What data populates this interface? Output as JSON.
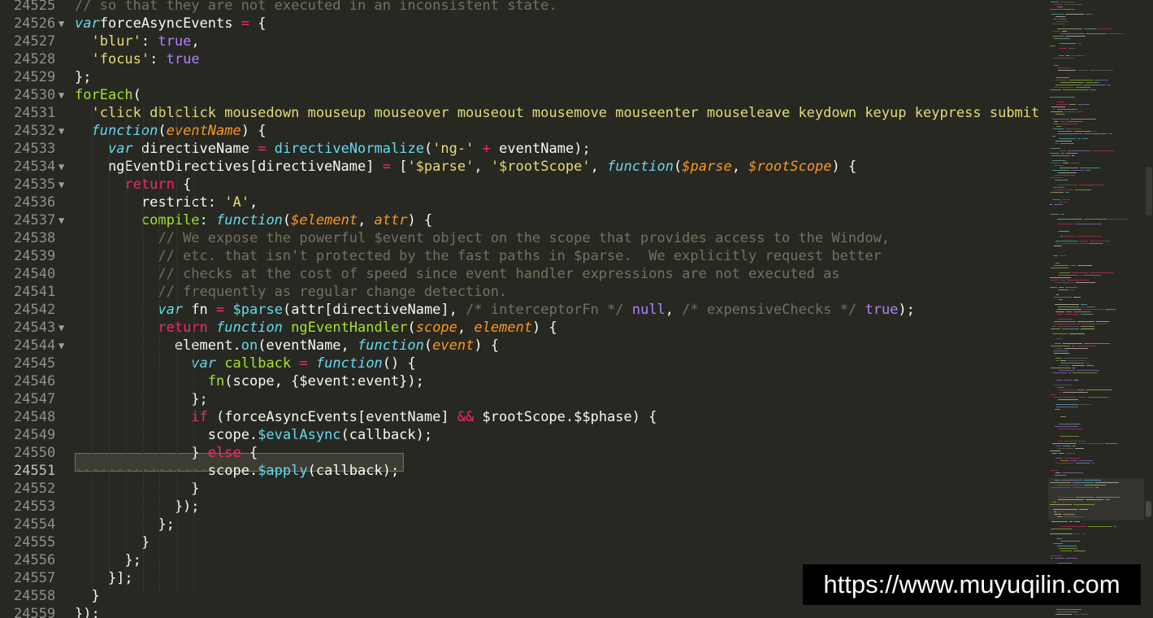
{
  "editor": {
    "gutter": {
      "line_numbers": [
        "24525",
        "24526",
        "24527",
        "24528",
        "24529",
        "24530",
        "24531",
        "24532",
        "24533",
        "24534",
        "24535",
        "24536",
        "24537",
        "24538",
        "24539",
        "24540",
        "24541",
        "24542",
        "24543",
        "24544",
        "24545",
        "24546",
        "24547",
        "24548",
        "24549",
        "24550",
        "24551",
        "24552",
        "24553",
        "24554",
        "24555",
        "24556",
        "24557",
        "24558",
        "24559"
      ],
      "fold_marker": "▼",
      "current_line": "24551"
    },
    "lines": [
      [
        [
          "c",
          "// so that they are not executed in an inconsistent state."
        ]
      ],
      [
        [
          "sv",
          "var"
        ],
        [
          "",
          "forceAsyncEvents "
        ],
        [
          "k",
          "="
        ],
        [
          "",
          " {"
        ]
      ],
      [
        [
          "",
          "  "
        ],
        [
          "s",
          "'blur'"
        ],
        [
          "",
          ": "
        ],
        [
          "n",
          "true"
        ],
        [
          "",
          ","
        ]
      ],
      [
        [
          "",
          "  "
        ],
        [
          "s",
          "'focus'"
        ],
        [
          "",
          ": "
        ],
        [
          "n",
          "true"
        ]
      ],
      [
        [
          "",
          "};"
        ]
      ],
      [
        [
          "f",
          "forEach"
        ],
        [
          "",
          "("
        ]
      ],
      [
        [
          "",
          "  "
        ],
        [
          "s",
          "'click dblclick mousedown mouseup mouseover mouseout mousemove mouseenter mouseleave keydown keyup keypress submit"
        ]
      ],
      [
        [
          "",
          "  "
        ],
        [
          "sv",
          "function"
        ],
        [
          "",
          "("
        ],
        [
          "p",
          "eventName"
        ],
        [
          "",
          ") {"
        ]
      ],
      [
        [
          "",
          "    "
        ],
        [
          "sv",
          "var"
        ],
        [
          "",
          " directiveName "
        ],
        [
          "k",
          "="
        ],
        [
          "",
          " "
        ],
        [
          "cy",
          "directiveNormalize"
        ],
        [
          "",
          "("
        ],
        [
          "s",
          "'ng-'"
        ],
        [
          "",
          " "
        ],
        [
          "k",
          "+"
        ],
        [
          "",
          " eventName);"
        ]
      ],
      [
        [
          "",
          "    ngEventDirectives[directiveName] "
        ],
        [
          "k",
          "="
        ],
        [
          "",
          " ["
        ],
        [
          "s",
          "'$parse'"
        ],
        [
          "",
          ", "
        ],
        [
          "s",
          "'$rootScope'"
        ],
        [
          "",
          ", "
        ],
        [
          "sv",
          "function"
        ],
        [
          "",
          "("
        ],
        [
          "p",
          "$parse"
        ],
        [
          "",
          ", "
        ],
        [
          "p",
          "$rootScope"
        ],
        [
          "",
          ") {"
        ]
      ],
      [
        [
          "",
          "      "
        ],
        [
          "k",
          "return"
        ],
        [
          "",
          " {"
        ]
      ],
      [
        [
          "",
          "        restrict: "
        ],
        [
          "s",
          "'A'"
        ],
        [
          "",
          ","
        ]
      ],
      [
        [
          "",
          "        "
        ],
        [
          "f",
          "compile"
        ],
        [
          "",
          ": "
        ],
        [
          "sv",
          "function"
        ],
        [
          "",
          "("
        ],
        [
          "p",
          "$element"
        ],
        [
          "",
          ", "
        ],
        [
          "p",
          "attr"
        ],
        [
          "",
          ") {"
        ]
      ],
      [
        [
          "",
          "          "
        ],
        [
          "c",
          "// We expose the powerful $event object on the scope that provides access to the Window,"
        ]
      ],
      [
        [
          "",
          "          "
        ],
        [
          "c",
          "// etc. that isn't protected by the fast paths in $parse.  We explicitly request better"
        ]
      ],
      [
        [
          "",
          "          "
        ],
        [
          "c",
          "// checks at the cost of speed since event handler expressions are not executed as"
        ]
      ],
      [
        [
          "",
          "          "
        ],
        [
          "c",
          "// frequently as regular change detection."
        ]
      ],
      [
        [
          "",
          "          "
        ],
        [
          "sv",
          "var"
        ],
        [
          "",
          " fn "
        ],
        [
          "k",
          "="
        ],
        [
          "",
          " "
        ],
        [
          "cy",
          "$parse"
        ],
        [
          "",
          "(attr[directiveName], "
        ],
        [
          "c",
          "/* interceptorFn */"
        ],
        [
          "",
          " "
        ],
        [
          "n",
          "null"
        ],
        [
          "",
          ", "
        ],
        [
          "c",
          "/* expensiveChecks */"
        ],
        [
          "",
          " "
        ],
        [
          "n",
          "true"
        ],
        [
          "",
          ");"
        ]
      ],
      [
        [
          "",
          "          "
        ],
        [
          "k",
          "return"
        ],
        [
          "",
          " "
        ],
        [
          "sv",
          "function"
        ],
        [
          "",
          " "
        ],
        [
          "f",
          "ngEventHandler"
        ],
        [
          "",
          "("
        ],
        [
          "p",
          "scope"
        ],
        [
          "",
          ", "
        ],
        [
          "p",
          "element"
        ],
        [
          "",
          ") {"
        ]
      ],
      [
        [
          "",
          "            element."
        ],
        [
          "cy",
          "on"
        ],
        [
          "",
          "(eventName, "
        ],
        [
          "sv",
          "function"
        ],
        [
          "",
          "("
        ],
        [
          "p",
          "event"
        ],
        [
          "",
          ") {"
        ]
      ],
      [
        [
          "",
          "              "
        ],
        [
          "sv",
          "var"
        ],
        [
          "",
          " "
        ],
        [
          "f",
          "callback"
        ],
        [
          "",
          " "
        ],
        [
          "k",
          "="
        ],
        [
          "",
          " "
        ],
        [
          "sv",
          "function"
        ],
        [
          "",
          "() {"
        ]
      ],
      [
        [
          "",
          "                "
        ],
        [
          "f",
          "fn"
        ],
        [
          "",
          "(scope, {$event:event});"
        ]
      ],
      [
        [
          "",
          "              };"
        ]
      ],
      [
        [
          "",
          "              "
        ],
        [
          "k",
          "if"
        ],
        [
          "",
          " (forceAsyncEvents[eventName] "
        ],
        [
          "k",
          "&&"
        ],
        [
          "",
          " $rootScope.$$phase) {"
        ]
      ],
      [
        [
          "",
          "                scope."
        ],
        [
          "cy",
          "$evalAsync"
        ],
        [
          "",
          "(callback);"
        ]
      ],
      [
        [
          "",
          "              } "
        ],
        [
          "k",
          "else"
        ],
        [
          "",
          " {"
        ]
      ],
      [
        [
          "ws",
          "················"
        ],
        [
          "",
          "scope."
        ],
        [
          "cy",
          "$apply"
        ],
        [
          "",
          "(callback);"
        ]
      ],
      [
        [
          "",
          "              }"
        ]
      ],
      [
        [
          "",
          "            });"
        ]
      ],
      [
        [
          "",
          "          };"
        ]
      ],
      [
        [
          "",
          "        }"
        ]
      ],
      [
        [
          "",
          "      };"
        ]
      ],
      [
        [
          "",
          "    }];"
        ]
      ],
      [
        [
          "",
          "  }"
        ]
      ],
      [
        [
          "",
          "});"
        ]
      ]
    ]
  },
  "watermark": {
    "text": "https://www.muyuqilin.com"
  }
}
